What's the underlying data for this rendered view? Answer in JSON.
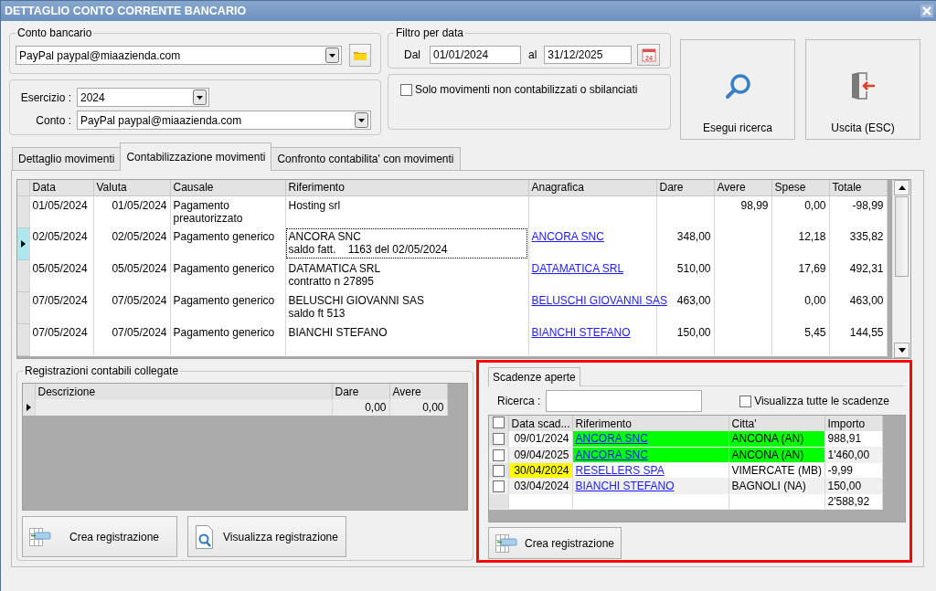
{
  "window": {
    "title": "DETTAGLIO CONTO CORRENTE BANCARIO"
  },
  "conto_bancario": {
    "legend": "Conto bancario",
    "value": "PayPal paypal@miaazienda.com"
  },
  "esercizio": {
    "label": "Esercizio :",
    "value": "2024"
  },
  "conto": {
    "label": "Conto :",
    "value": "PayPal paypal@miaazienda.com"
  },
  "filtro": {
    "legend": "Filtro per data",
    "from_label": "Dal",
    "from": "01/01/2024",
    "to_label": "al",
    "to": "31/12/2025",
    "calendar_day": "24"
  },
  "solo_movimenti": {
    "label": "Solo movimenti non contabilizzati o sbilanciati",
    "checked": false
  },
  "actions": [
    {
      "kind": "search",
      "label": "Esegui ricerca"
    },
    {
      "kind": "exit",
      "label": "Uscita (ESC)"
    }
  ],
  "tabs": [
    {
      "label": "Dettaglio movimenti",
      "selected": false
    },
    {
      "label": "Contabilizzazione movimenti",
      "selected": true
    },
    {
      "label": "Confronto contabilita' con movimenti",
      "selected": false
    }
  ],
  "movimenti": {
    "columns": [
      "Data",
      "Valuta",
      "Causale",
      "Riferimento",
      "Anagrafica",
      "Dare",
      "Avere",
      "Spese",
      "Totale"
    ],
    "rows": [
      {
        "data": "01/05/2024",
        "valuta": "01/05/2024",
        "causale": "Pagamento preautorizzato",
        "riferimento": "Hosting srl",
        "avere": "98,99",
        "spese": "0,00",
        "totale": "-98,99",
        "selected": false
      },
      {
        "data": "02/05/2024",
        "valuta": "02/05/2024",
        "causale": "Pagamento generico",
        "riferimento": "ANCORA SNC\nsaldo fatt.    1163 del 02/05/2024",
        "anagrafica": "ANCORA SNC",
        "dare": "348,00",
        "spese": "12,18",
        "totale": "335,82",
        "selected": true
      },
      {
        "data": "05/05/2024",
        "valuta": "05/05/2024",
        "causale": "Pagamento generico",
        "riferimento": "DATAMATICA SRL\ncontratto n 27895",
        "anagrafica": "DATAMATICA SRL",
        "dare": "510,00",
        "spese": "17,69",
        "totale": "492,31",
        "selected": false
      },
      {
        "data": "07/05/2024",
        "valuta": "07/05/2024",
        "causale": "Pagamento generico",
        "riferimento": "BELUSCHI GIOVANNI SAS\nsaldo ft 513",
        "anagrafica": "BELUSCHI GIOVANNI SAS",
        "dare": "463,00",
        "spese": "0,00",
        "totale": "463,00",
        "selected": false
      },
      {
        "data": "07/05/2024",
        "valuta": "07/05/2024",
        "causale": "Pagamento generico",
        "riferimento": "BIANCHI STEFANO",
        "anagrafica": "BIANCHI STEFANO",
        "dare": "150,00",
        "spese": "5,45",
        "totale": "144,55",
        "selected": false
      }
    ]
  },
  "registrazioni": {
    "legend": "Registrazioni contabili collegate",
    "columns": [
      "Descrizione",
      "Dare",
      "Avere"
    ],
    "rows": [
      {
        "dare": "0,00",
        "avere": "0,00",
        "selected": true
      }
    ],
    "buttons": [
      {
        "kind": "create",
        "label": "Crea registrazione"
      },
      {
        "kind": "view",
        "label": "Visualizza registrazione"
      }
    ]
  },
  "scadenze": {
    "tab": "Scadenze aperte",
    "search_label": "Ricerca :",
    "show_all": {
      "label": "Visualizza tutte le scadenze",
      "checked": false
    },
    "all_checked": false,
    "columns": [
      "Data scad...",
      "Riferimento",
      "Citta'",
      "Importo"
    ],
    "rows": [
      {
        "checked": false,
        "data": "09/01/2024",
        "riferimento": "ANCORA SNC",
        "citta": "ANCONA (AN)",
        "importo": "988,91",
        "kind": "reference",
        "color": "#00ff00"
      },
      {
        "checked": false,
        "data": "09/04/2025",
        "riferimento": "ANCORA SNC",
        "citta": "ANCONA (AN)",
        "importo": "1'460,00",
        "kind": "reference",
        "color": "#00ff00"
      },
      {
        "checked": false,
        "data": "30/04/2024",
        "riferimento": "RESELLERS SPA",
        "citta": "VIMERCATE (MB)",
        "importo": "-9,99",
        "kind": "date",
        "color": "#ffff00"
      },
      {
        "checked": false,
        "data": "03/04/2024",
        "riferimento": "BIANCHI STEFANO",
        "citta": "BAGNOLI (NA)",
        "importo": "150,00",
        "kind": "plain"
      }
    ],
    "total": "2'588,92",
    "button": {
      "kind": "create",
      "label": "Crea registrazione"
    }
  }
}
